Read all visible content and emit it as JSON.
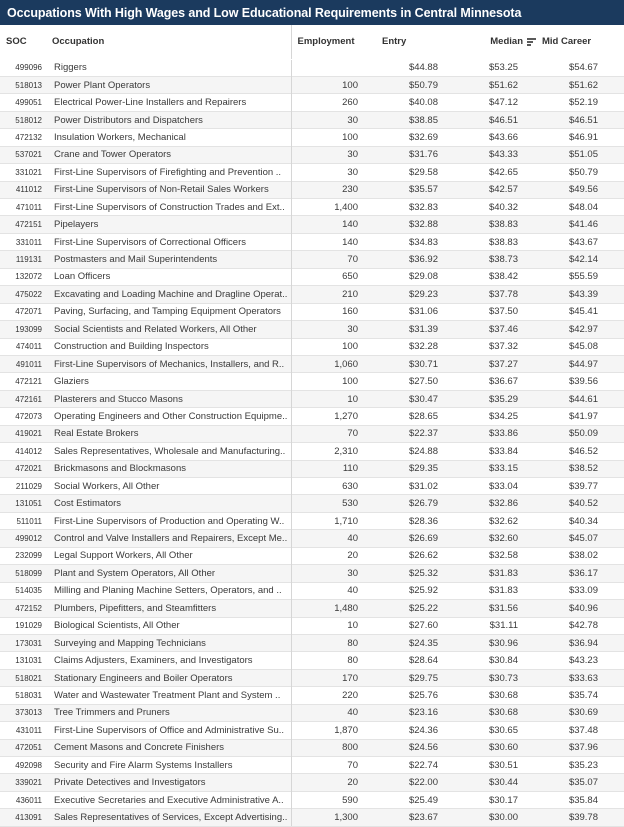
{
  "title": "Occupations With High Wages and Low Educational Requirements in Central Minnesota",
  "colors": {
    "title_bar": "#1B3A5E",
    "row_alt": "#f5f5f5",
    "grid_line": "#e3e3e3",
    "text": "#333333"
  },
  "sort": {
    "column": "Median",
    "direction": "descending",
    "icon": "sort-descending-icon"
  },
  "columns": [
    {
      "key": "soc",
      "label": "SOC",
      "align": "left"
    },
    {
      "key": "occ",
      "label": "Occupation",
      "align": "left"
    },
    {
      "key": "emp",
      "label": "Employment",
      "align": "right"
    },
    {
      "key": "entry",
      "label": "Entry",
      "align": "right"
    },
    {
      "key": "median",
      "label": "Median",
      "align": "right"
    },
    {
      "key": "mid",
      "label": "Mid Career",
      "align": "right"
    }
  ],
  "rows": [
    {
      "soc": "499096",
      "occ": "Riggers",
      "emp": "",
      "entry": "$44.88",
      "median": "$53.25",
      "mid": "$54.67"
    },
    {
      "soc": "518013",
      "occ": "Power Plant Operators",
      "emp": "100",
      "entry": "$50.79",
      "median": "$51.62",
      "mid": "$51.62"
    },
    {
      "soc": "499051",
      "occ": "Electrical Power-Line Installers and Repairers",
      "emp": "260",
      "entry": "$40.08",
      "median": "$47.12",
      "mid": "$52.19"
    },
    {
      "soc": "518012",
      "occ": "Power Distributors and Dispatchers",
      "emp": "30",
      "entry": "$38.85",
      "median": "$46.51",
      "mid": "$46.51"
    },
    {
      "soc": "472132",
      "occ": "Insulation Workers, Mechanical",
      "emp": "100",
      "entry": "$32.69",
      "median": "$43.66",
      "mid": "$46.91"
    },
    {
      "soc": "537021",
      "occ": "Crane and Tower Operators",
      "emp": "30",
      "entry": "$31.76",
      "median": "$43.33",
      "mid": "$51.05"
    },
    {
      "soc": "331021",
      "occ": "First-Line Supervisors of Firefighting and Prevention ..",
      "emp": "30",
      "entry": "$29.58",
      "median": "$42.65",
      "mid": "$50.79"
    },
    {
      "soc": "411012",
      "occ": "First-Line Supervisors of Non-Retail Sales Workers",
      "emp": "230",
      "entry": "$35.57",
      "median": "$42.57",
      "mid": "$49.56"
    },
    {
      "soc": "471011",
      "occ": "First-Line Supervisors of Construction Trades and Ext..",
      "emp": "1,400",
      "entry": "$32.83",
      "median": "$40.32",
      "mid": "$48.04"
    },
    {
      "soc": "472151",
      "occ": "Pipelayers",
      "emp": "140",
      "entry": "$32.88",
      "median": "$38.83",
      "mid": "$41.46"
    },
    {
      "soc": "331011",
      "occ": "First-Line Supervisors of Correctional Officers",
      "emp": "140",
      "entry": "$34.83",
      "median": "$38.83",
      "mid": "$43.67"
    },
    {
      "soc": "119131",
      "occ": "Postmasters and Mail Superintendents",
      "emp": "70",
      "entry": "$36.92",
      "median": "$38.73",
      "mid": "$42.14"
    },
    {
      "soc": "132072",
      "occ": "Loan Officers",
      "emp": "650",
      "entry": "$29.08",
      "median": "$38.42",
      "mid": "$55.59"
    },
    {
      "soc": "475022",
      "occ": "Excavating and Loading Machine and Dragline Operat..",
      "emp": "210",
      "entry": "$29.23",
      "median": "$37.78",
      "mid": "$43.39"
    },
    {
      "soc": "472071",
      "occ": "Paving, Surfacing, and Tamping Equipment Operators",
      "emp": "160",
      "entry": "$31.06",
      "median": "$37.50",
      "mid": "$45.41"
    },
    {
      "soc": "193099",
      "occ": "Social Scientists and Related Workers, All Other",
      "emp": "30",
      "entry": "$31.39",
      "median": "$37.46",
      "mid": "$42.97"
    },
    {
      "soc": "474011",
      "occ": "Construction and Building Inspectors",
      "emp": "100",
      "entry": "$32.28",
      "median": "$37.32",
      "mid": "$45.08"
    },
    {
      "soc": "491011",
      "occ": "First-Line Supervisors of Mechanics, Installers, and R..",
      "emp": "1,060",
      "entry": "$30.71",
      "median": "$37.27",
      "mid": "$44.97"
    },
    {
      "soc": "472121",
      "occ": "Glaziers",
      "emp": "100",
      "entry": "$27.50",
      "median": "$36.67",
      "mid": "$39.56"
    },
    {
      "soc": "472161",
      "occ": "Plasterers and Stucco Masons",
      "emp": "10",
      "entry": "$30.47",
      "median": "$35.29",
      "mid": "$44.61"
    },
    {
      "soc": "472073",
      "occ": "Operating Engineers and Other Construction Equipme..",
      "emp": "1,270",
      "entry": "$28.65",
      "median": "$34.25",
      "mid": "$41.97"
    },
    {
      "soc": "419021",
      "occ": "Real Estate Brokers",
      "emp": "70",
      "entry": "$22.37",
      "median": "$33.86",
      "mid": "$50.09"
    },
    {
      "soc": "414012",
      "occ": "Sales Representatives, Wholesale and Manufacturing..",
      "emp": "2,310",
      "entry": "$24.88",
      "median": "$33.84",
      "mid": "$46.52"
    },
    {
      "soc": "472021",
      "occ": "Brickmasons and Blockmasons",
      "emp": "110",
      "entry": "$29.35",
      "median": "$33.15",
      "mid": "$38.52"
    },
    {
      "soc": "211029",
      "occ": "Social Workers, All Other",
      "emp": "630",
      "entry": "$31.02",
      "median": "$33.04",
      "mid": "$39.77"
    },
    {
      "soc": "131051",
      "occ": "Cost Estimators",
      "emp": "530",
      "entry": "$26.79",
      "median": "$32.86",
      "mid": "$40.52"
    },
    {
      "soc": "511011",
      "occ": "First-Line Supervisors of Production and Operating W..",
      "emp": "1,710",
      "entry": "$28.36",
      "median": "$32.62",
      "mid": "$40.34"
    },
    {
      "soc": "499012",
      "occ": "Control and Valve Installers and Repairers, Except Me..",
      "emp": "40",
      "entry": "$26.69",
      "median": "$32.60",
      "mid": "$45.07"
    },
    {
      "soc": "232099",
      "occ": "Legal Support Workers, All Other",
      "emp": "20",
      "entry": "$26.62",
      "median": "$32.58",
      "mid": "$38.02"
    },
    {
      "soc": "518099",
      "occ": "Plant and System Operators, All Other",
      "emp": "30",
      "entry": "$25.32",
      "median": "$31.83",
      "mid": "$36.17"
    },
    {
      "soc": "514035",
      "occ": "Milling and Planing Machine Setters, Operators, and ..",
      "emp": "40",
      "entry": "$25.92",
      "median": "$31.83",
      "mid": "$33.09"
    },
    {
      "soc": "472152",
      "occ": "Plumbers, Pipefitters, and Steamfitters",
      "emp": "1,480",
      "entry": "$25.22",
      "median": "$31.56",
      "mid": "$40.96"
    },
    {
      "soc": "191029",
      "occ": "Biological Scientists, All Other",
      "emp": "10",
      "entry": "$27.60",
      "median": "$31.11",
      "mid": "$42.78"
    },
    {
      "soc": "173031",
      "occ": "Surveying and Mapping Technicians",
      "emp": "80",
      "entry": "$24.35",
      "median": "$30.96",
      "mid": "$36.94"
    },
    {
      "soc": "131031",
      "occ": "Claims Adjusters, Examiners, and Investigators",
      "emp": "80",
      "entry": "$28.64",
      "median": "$30.84",
      "mid": "$43.23"
    },
    {
      "soc": "518021",
      "occ": "Stationary Engineers and Boiler Operators",
      "emp": "170",
      "entry": "$29.75",
      "median": "$30.73",
      "mid": "$33.63"
    },
    {
      "soc": "518031",
      "occ": "Water and Wastewater Treatment Plant and System ..",
      "emp": "220",
      "entry": "$25.76",
      "median": "$30.68",
      "mid": "$35.74"
    },
    {
      "soc": "373013",
      "occ": "Tree Trimmers and Pruners",
      "emp": "40",
      "entry": "$23.16",
      "median": "$30.68",
      "mid": "$30.69"
    },
    {
      "soc": "431011",
      "occ": "First-Line Supervisors of Office and Administrative Su..",
      "emp": "1,870",
      "entry": "$24.36",
      "median": "$30.65",
      "mid": "$37.48"
    },
    {
      "soc": "472051",
      "occ": "Cement Masons and Concrete Finishers",
      "emp": "800",
      "entry": "$24.56",
      "median": "$30.60",
      "mid": "$37.96"
    },
    {
      "soc": "492098",
      "occ": "Security and Fire Alarm Systems Installers",
      "emp": "70",
      "entry": "$22.74",
      "median": "$30.51",
      "mid": "$35.23"
    },
    {
      "soc": "339021",
      "occ": "Private Detectives and Investigators",
      "emp": "20",
      "entry": "$22.00",
      "median": "$30.44",
      "mid": "$35.07"
    },
    {
      "soc": "436011",
      "occ": "Executive Secretaries and Executive Administrative A..",
      "emp": "590",
      "entry": "$25.49",
      "median": "$30.17",
      "mid": "$35.84"
    },
    {
      "soc": "413091",
      "occ": "Sales Representatives of Services, Except Advertising..",
      "emp": "1,300",
      "entry": "$23.67",
      "median": "$30.00",
      "mid": "$39.78"
    }
  ]
}
